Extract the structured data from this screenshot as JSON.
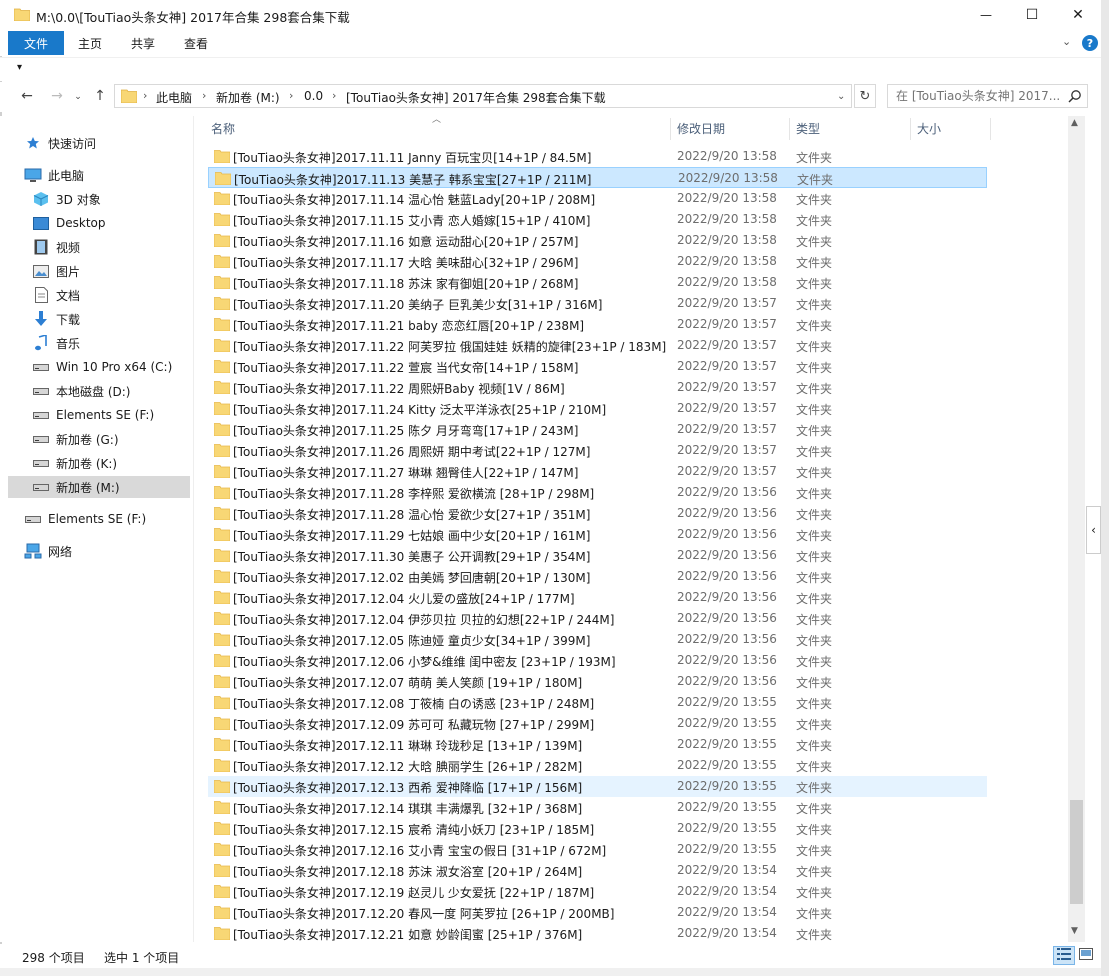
{
  "window": {
    "title": "M:\\0.0\\[TouTiao头条女神] 2017年合集 298套合集下载",
    "minimize_glyph": "—",
    "maximize_glyph": "☐",
    "close_glyph": "✕"
  },
  "ribbon": {
    "tabs": [
      {
        "label": "文件"
      },
      {
        "label": "主页"
      },
      {
        "label": "共享"
      },
      {
        "label": "查看"
      }
    ],
    "expand_glyph": "⌄",
    "help_glyph": "?"
  },
  "quick_access_toolbar": {
    "dropdown_glyph": "▾"
  },
  "navigation": {
    "back_glyph": "←",
    "forward_glyph": "→",
    "history_glyph": "⌄",
    "up_glyph": "↑",
    "breadcrumb": [
      "此电脑",
      "新加卷 (M:)",
      "0.0",
      "[TouTiao头条女神] 2017年合集 298套合集下载"
    ],
    "separator": "›",
    "dropdown_glyph": "⌄",
    "refresh_glyph": "↻",
    "search_placeholder": "在 [TouTiao头条女神] 2017..."
  },
  "sidebar": {
    "items": [
      {
        "label": "快速访问",
        "icon": "star-icon"
      },
      {
        "label": "此电脑",
        "icon": "computer-icon"
      },
      {
        "label": "3D 对象",
        "icon": "3d-objects-icon"
      },
      {
        "label": "Desktop",
        "icon": "desktop-icon"
      },
      {
        "label": "视频",
        "icon": "video-icon"
      },
      {
        "label": "图片",
        "icon": "pictures-icon"
      },
      {
        "label": "文档",
        "icon": "documents-icon"
      },
      {
        "label": "下载",
        "icon": "download-icon"
      },
      {
        "label": "音乐",
        "icon": "music-icon"
      },
      {
        "label": "Win 10 Pro x64 (C:)",
        "icon": "drive-icon"
      },
      {
        "label": "本地磁盘 (D:)",
        "icon": "drive-icon"
      },
      {
        "label": "Elements SE (F:)",
        "icon": "drive-icon"
      },
      {
        "label": "新加卷 (G:)",
        "icon": "drive-icon"
      },
      {
        "label": "新加卷 (K:)",
        "icon": "drive-icon"
      },
      {
        "label": "新加卷 (M:)",
        "icon": "drive-icon",
        "selected": true
      },
      {
        "label": "Elements SE (F:)",
        "icon": "drive-icon"
      },
      {
        "label": "网络",
        "icon": "network-icon"
      }
    ]
  },
  "columns": {
    "name": "名称",
    "modified": "修改日期",
    "type": "类型",
    "size": "大小"
  },
  "files": [
    {
      "name": "[TouTiao头条女神]2017.11.11 Janny 百玩宝贝[14+1P / 84.5M]",
      "modified": "2022/9/20 13:58",
      "type": "文件夹"
    },
    {
      "name": "[TouTiao头条女神]2017.11.13 美慧子 韩系宝宝[27+1P / 211M]",
      "modified": "2022/9/20 13:58",
      "type": "文件夹",
      "state": "selected"
    },
    {
      "name": "[TouTiao头条女神]2017.11.14 温心怡 魅蓝Lady[20+1P / 208M]",
      "modified": "2022/9/20 13:58",
      "type": "文件夹"
    },
    {
      "name": "[TouTiao头条女神]2017.11.15 艾小青 恋人婚嫁[15+1P / 410M]",
      "modified": "2022/9/20 13:58",
      "type": "文件夹"
    },
    {
      "name": "[TouTiao头条女神]2017.11.16 如意 运动甜心[20+1P / 257M]",
      "modified": "2022/9/20 13:58",
      "type": "文件夹"
    },
    {
      "name": "[TouTiao头条女神]2017.11.17 大晗 美味甜心[32+1P / 296M]",
      "modified": "2022/9/20 13:58",
      "type": "文件夹"
    },
    {
      "name": "[TouTiao头条女神]2017.11.18 苏沫 家有御姐[20+1P / 268M]",
      "modified": "2022/9/20 13:58",
      "type": "文件夹"
    },
    {
      "name": "[TouTiao头条女神]2017.11.20 美纳子 巨乳美少女[31+1P / 316M]",
      "modified": "2022/9/20 13:57",
      "type": "文件夹"
    },
    {
      "name": "[TouTiao头条女神]2017.11.21 baby 恋恋红唇[20+1P / 238M]",
      "modified": "2022/9/20 13:57",
      "type": "文件夹"
    },
    {
      "name": "[TouTiao头条女神]2017.11.22 阿芙罗拉 俄国娃娃 妖精的旋律[23+1P / 183M]",
      "modified": "2022/9/20 13:57",
      "type": "文件夹"
    },
    {
      "name": "[TouTiao头条女神]2017.11.22 萱宸 当代女帝[14+1P / 158M]",
      "modified": "2022/9/20 13:57",
      "type": "文件夹"
    },
    {
      "name": "[TouTiao头条女神]2017.11.22 周熙妍Baby 视频[1V / 86M]",
      "modified": "2022/9/20 13:57",
      "type": "文件夹"
    },
    {
      "name": "[TouTiao头条女神]2017.11.24 Kitty 泛太平洋泳衣[25+1P / 210M]",
      "modified": "2022/9/20 13:57",
      "type": "文件夹"
    },
    {
      "name": "[TouTiao头条女神]2017.11.25 陈夕 月牙弯弯[17+1P / 243M]",
      "modified": "2022/9/20 13:57",
      "type": "文件夹"
    },
    {
      "name": "[TouTiao头条女神]2017.11.26 周熙妍 期中考试[22+1P / 127M]",
      "modified": "2022/9/20 13:57",
      "type": "文件夹"
    },
    {
      "name": "[TouTiao头条女神]2017.11.27 琳琳 翘臀佳人[22+1P / 147M]",
      "modified": "2022/9/20 13:57",
      "type": "文件夹"
    },
    {
      "name": "[TouTiao头条女神]2017.11.28 李梓熙 爱欲横流 [28+1P / 298M]",
      "modified": "2022/9/20 13:56",
      "type": "文件夹"
    },
    {
      "name": "[TouTiao头条女神]2017.11.28 温心怡 爱欲少女[27+1P / 351M]",
      "modified": "2022/9/20 13:56",
      "type": "文件夹"
    },
    {
      "name": "[TouTiao头条女神]2017.11.29 七姑娘 画中少女[20+1P / 161M]",
      "modified": "2022/9/20 13:56",
      "type": "文件夹"
    },
    {
      "name": "[TouTiao头条女神]2017.11.30 美惠子 公开调教[29+1P / 354M]",
      "modified": "2022/9/20 13:56",
      "type": "文件夹"
    },
    {
      "name": "[TouTiao头条女神]2017.12.02 由美嫣 梦回唐朝[20+1P / 130M]",
      "modified": "2022/9/20 13:56",
      "type": "文件夹"
    },
    {
      "name": "[TouTiao头条女神]2017.12.04 火儿爱の盛放[24+1P / 177M]",
      "modified": "2022/9/20 13:56",
      "type": "文件夹"
    },
    {
      "name": "[TouTiao头条女神]2017.12.04 伊莎贝拉 贝拉的幻想[22+1P / 244M]",
      "modified": "2022/9/20 13:56",
      "type": "文件夹"
    },
    {
      "name": "[TouTiao头条女神]2017.12.05 陈迪娅 童贞少女[34+1P / 399M]",
      "modified": "2022/9/20 13:56",
      "type": "文件夹"
    },
    {
      "name": "[TouTiao头条女神]2017.12.06 小梦&维维 闺中密友 [23+1P / 193M]",
      "modified": "2022/9/20 13:56",
      "type": "文件夹"
    },
    {
      "name": "[TouTiao头条女神]2017.12.07 萌萌 美人笑颜 [19+1P / 180M]",
      "modified": "2022/9/20 13:56",
      "type": "文件夹"
    },
    {
      "name": "[TouTiao头条女神]2017.12.08 丁筱楠 白の诱惑 [23+1P / 248M]",
      "modified": "2022/9/20 13:55",
      "type": "文件夹"
    },
    {
      "name": "[TouTiao头条女神]2017.12.09 苏可可 私藏玩物 [27+1P / 299M]",
      "modified": "2022/9/20 13:55",
      "type": "文件夹"
    },
    {
      "name": "[TouTiao头条女神]2017.12.11 琳琳 玲珑秒足 [13+1P / 139M]",
      "modified": "2022/9/20 13:55",
      "type": "文件夹"
    },
    {
      "name": "[TouTiao头条女神]2017.12.12 大晗 腆丽学生 [26+1P / 282M]",
      "modified": "2022/9/20 13:55",
      "type": "文件夹"
    },
    {
      "name": "[TouTiao头条女神]2017.12.13 西希 爱神降临 [17+1P / 156M]",
      "modified": "2022/9/20 13:55",
      "type": "文件夹",
      "state": "hover"
    },
    {
      "name": "[TouTiao头条女神]2017.12.14 琪琪 丰满爆乳 [32+1P / 368M]",
      "modified": "2022/9/20 13:55",
      "type": "文件夹"
    },
    {
      "name": "[TouTiao头条女神]2017.12.15 宸希 清纯小妖刀 [23+1P / 185M]",
      "modified": "2022/9/20 13:55",
      "type": "文件夹"
    },
    {
      "name": "[TouTiao头条女神]2017.12.16 艾小青 宝宝の假日 [31+1P / 672M]",
      "modified": "2022/9/20 13:55",
      "type": "文件夹"
    },
    {
      "name": "[TouTiao头条女神]2017.12.18 苏沫 淑女浴室 [20+1P / 264M]",
      "modified": "2022/9/20 13:54",
      "type": "文件夹"
    },
    {
      "name": "[TouTiao头条女神]2017.12.19 赵灵儿 少女爱抚 [22+1P / 187M]",
      "modified": "2022/9/20 13:54",
      "type": "文件夹"
    },
    {
      "name": "[TouTiao头条女神]2017.12.20 春风一度 阿芙罗拉 [26+1P / 200MB]",
      "modified": "2022/9/20 13:54",
      "type": "文件夹"
    },
    {
      "name": "[TouTiao头条女神]2017.12.21 如意 妙龄闺蜜 [25+1P / 376M]",
      "modified": "2022/9/20 13:54",
      "type": "文件夹"
    }
  ],
  "scrollbar": {
    "thumb_start_fraction": 0.84,
    "thumb_end_fraction": 0.97
  },
  "status": {
    "item_count": "298 个项目",
    "selection": "选中 1 个项目"
  },
  "colors": {
    "accent": "#1979ca",
    "selected_row": "#cce8ff",
    "hover_row": "#e5f3ff",
    "folder": "#f8d775",
    "folder_dark": "#e6b84a"
  }
}
